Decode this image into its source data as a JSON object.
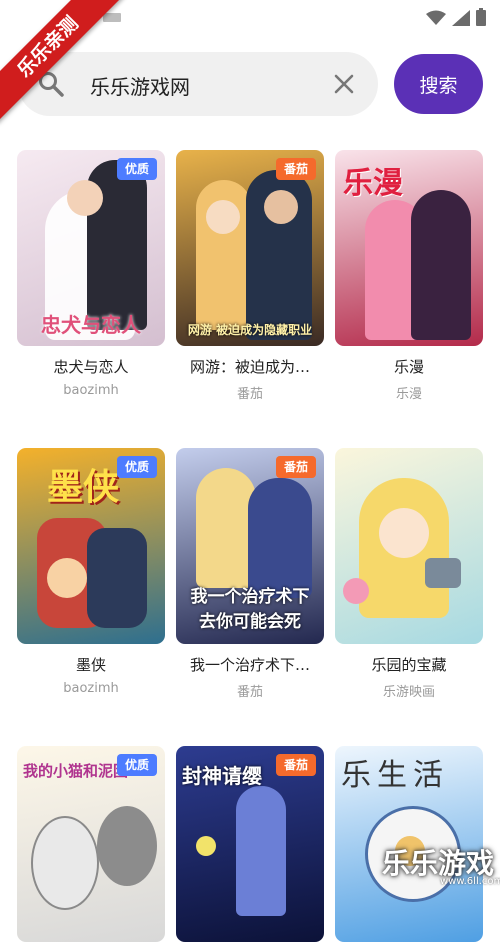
{
  "ribbon": {
    "text": "乐乐亲测"
  },
  "search": {
    "value": "乐乐游戏网",
    "button_label": "搜索"
  },
  "status_bar": {
    "icons": [
      "wifi-icon",
      "signal-icon",
      "battery-icon"
    ]
  },
  "cards": [
    {
      "name": "忠犬与恋人",
      "source": "baozimh",
      "badge": "优质",
      "badge_color": "#4d7cff",
      "cover_text": "忠犬与恋人",
      "cover_bg": [
        "#f5e6ee",
        "#d9c3d1"
      ]
    },
    {
      "name": "网游：被迫成为…",
      "source": "番茄",
      "badge": "番茄",
      "badge_color": "#f56a2c",
      "cover_text": "网游 被迫成为隐藏职业",
      "cover_bg": [
        "#e0a640",
        "#3a2a24"
      ]
    },
    {
      "name": "乐漫",
      "source": "乐漫",
      "badge": "",
      "badge_color": "",
      "cover_text": "乐漫",
      "cover_bg": [
        "#e7364e",
        "#7a2a48"
      ]
    },
    {
      "name": "墨侠",
      "source": "baozimh",
      "badge": "优质",
      "badge_color": "#4d7cff",
      "cover_text": "墨侠",
      "cover_bg": [
        "#f3a31f",
        "#2d6e8e"
      ]
    },
    {
      "name": "我一个治疗术下…",
      "source": "番茄",
      "badge": "番茄",
      "badge_color": "#f56a2c",
      "cover_text": "我一个治疗术下去你可能会死",
      "cover_bg": [
        "#b9c6e8",
        "#2c2f5a"
      ]
    },
    {
      "name": "乐园的宝藏",
      "source": "乐游映画",
      "badge": "",
      "badge_color": "",
      "cover_text": "",
      "cover_bg": [
        "#f7f2d6",
        "#9fd5e0"
      ]
    },
    {
      "name": "",
      "source": "",
      "badge": "优质",
      "badge_color": "#4d7cff",
      "cover_text": "我的小猫和泥团",
      "cover_bg": [
        "#fbf5e6",
        "#cfcfcf"
      ]
    },
    {
      "name": "",
      "source": "",
      "badge": "番茄",
      "badge_color": "#f56a2c",
      "cover_text": "封神请缨",
      "cover_bg": [
        "#2a3b8e",
        "#0e1440"
      ]
    },
    {
      "name": "",
      "source": "",
      "badge": "",
      "badge_color": "",
      "cover_text": "乐生活",
      "cover_bg": [
        "#e6f1fb",
        "#4a9ae0"
      ]
    }
  ],
  "watermark": {
    "text": "乐乐游戏",
    "url": "www.6ll.com"
  }
}
